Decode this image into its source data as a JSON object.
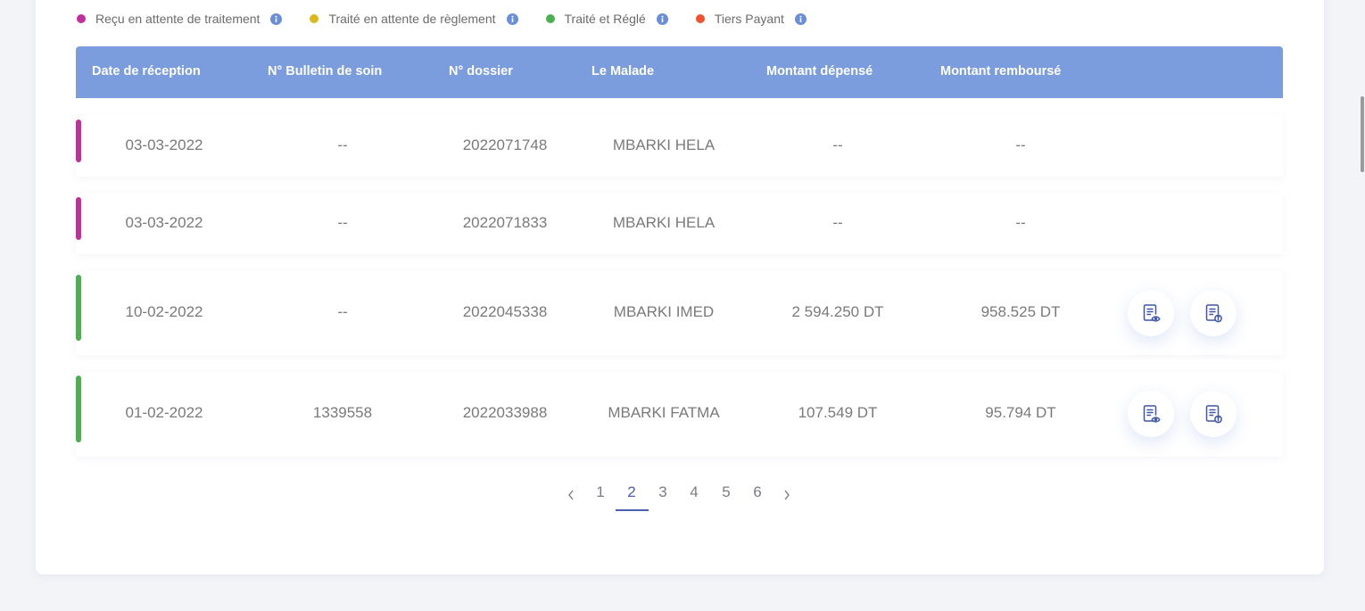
{
  "legend": {
    "items": [
      {
        "label": "Reçu en attente de traitement",
        "color": "#c02f9a"
      },
      {
        "label": "Traité en attente de règlement",
        "color": "#dcb81c"
      },
      {
        "label": "Traité et Réglé",
        "color": "#4caf50"
      },
      {
        "label": "Tiers Payant",
        "color": "#f0532d"
      }
    ],
    "info_icon_color": "#6b8fd6"
  },
  "table": {
    "headers": [
      "Date de réception",
      "N° Bulletin de soin",
      "N° dossier",
      "Le Malade",
      "Montant dépensé",
      "Montant remboursé"
    ],
    "rows": [
      {
        "date": "03-03-2022",
        "bulletin": "--",
        "dossier": "2022071748",
        "malade": "MBARKI HELA",
        "depense": "--",
        "rembourse": "--",
        "status_color": "#c02f9a",
        "actions": false
      },
      {
        "date": "03-03-2022",
        "bulletin": "--",
        "dossier": "2022071833",
        "malade": "MBARKI HELA",
        "depense": "--",
        "rembourse": "--",
        "status_color": "#c02f9a",
        "actions": false
      },
      {
        "date": "10-02-2022",
        "bulletin": "--",
        "dossier": "2022045338",
        "malade": "MBARKI IMED",
        "depense": "2 594.250 DT",
        "rembourse": "958.525 DT",
        "status_color": "#4caf50",
        "actions": true
      },
      {
        "date": "01-02-2022",
        "bulletin": "1339558",
        "dossier": "2022033988",
        "malade": "MBARKI FATMA",
        "depense": "107.549 DT",
        "rembourse": "95.794 DT",
        "status_color": "#4caf50",
        "actions": true
      }
    ],
    "action_icons": [
      "document-view-icon",
      "document-info-icon"
    ]
  },
  "pagination": {
    "pages": [
      "1",
      "2",
      "3",
      "4",
      "5",
      "6"
    ],
    "current": "2",
    "prev_icon": "chevron-left-icon",
    "next_icon": "chevron-right-icon"
  },
  "colors": {
    "header_bg": "#7b9ddd",
    "accent": "#4a5fb0"
  }
}
